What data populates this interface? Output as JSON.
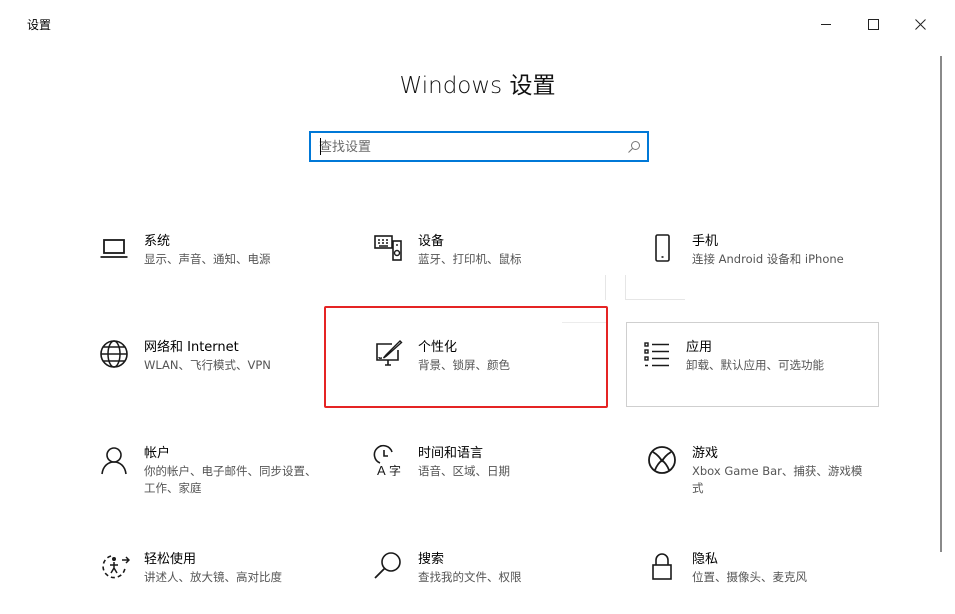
{
  "window": {
    "title": "设置"
  },
  "header": {
    "title": "Windows 设置"
  },
  "search": {
    "placeholder": "查找设置"
  },
  "tiles": [
    {
      "title": "系统",
      "desc": "显示、声音、通知、电源",
      "icon": "laptop-icon"
    },
    {
      "title": "设备",
      "desc": "蓝牙、打印机、鼠标",
      "icon": "devices-icon"
    },
    {
      "title": "手机",
      "desc": "连接 Android 设备和 iPhone",
      "icon": "phone-icon"
    },
    {
      "title": "网络和 Internet",
      "desc": "WLAN、飞行模式、VPN",
      "icon": "globe-icon"
    },
    {
      "title": "个性化",
      "desc": "背景、锁屏、颜色",
      "icon": "personalization-icon"
    },
    {
      "title": "应用",
      "desc": "卸载、默认应用、可选功能",
      "icon": "apps-list-icon"
    },
    {
      "title": "帐户",
      "desc": "你的帐户、电子邮件、同步设置、工作、家庭",
      "icon": "person-icon"
    },
    {
      "title": "时间和语言",
      "desc": "语音、区域、日期",
      "icon": "time-language-icon"
    },
    {
      "title": "游戏",
      "desc": "Xbox Game Bar、捕获、游戏模式",
      "icon": "xbox-icon"
    },
    {
      "title": "轻松使用",
      "desc": "讲述人、放大镜、高对比度",
      "icon": "ease-of-access-icon"
    },
    {
      "title": "搜索",
      "desc": "查找我的文件、权限",
      "icon": "search-magnifier-icon"
    },
    {
      "title": "隐私",
      "desc": "位置、摄像头、麦克风",
      "icon": "lock-icon"
    }
  ],
  "colors": {
    "accent": "#0078d7",
    "highlight": "#e52424",
    "icon": "#1a1a1a"
  }
}
